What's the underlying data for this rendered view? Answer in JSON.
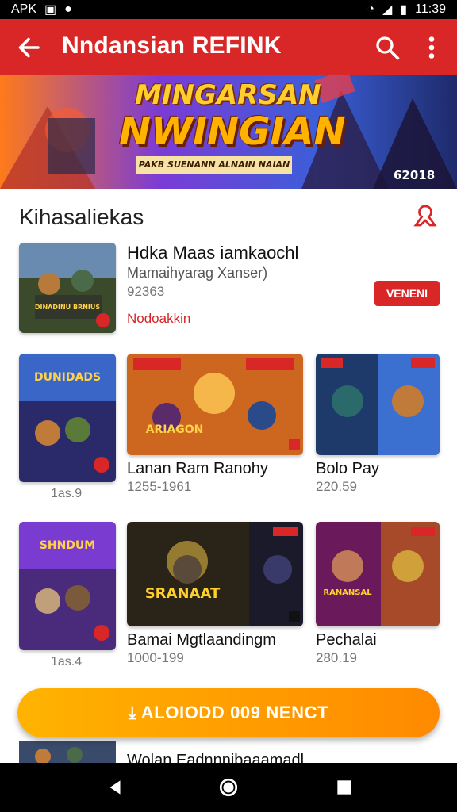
{
  "status": {
    "carrier": "APK",
    "time": "11:39"
  },
  "appbar": {
    "title": "Nndansian REFINK"
  },
  "banner": {
    "title1": "MINGARSAN",
    "title2": "NWINGIAN",
    "subtitle": "PAKB SUENANN ALNAIN NAIAN",
    "tag": "62018"
  },
  "section": {
    "title": "Kihasaliekas"
  },
  "featured": {
    "name": "Hdka Maas iamkaochl",
    "subtitle": "Mamaihyarag Xanser)",
    "meta": "92363",
    "link": "Nodoakkin",
    "button": "VENENI",
    "art": "DINADINU BRNIUS"
  },
  "cards": [
    {
      "title": "",
      "meta": "1as.9",
      "art": "DUNIDADS"
    },
    {
      "title": "Lanan Ram Ranohy",
      "meta": "1255-1961",
      "art": "ARIAGON"
    },
    {
      "title": "Bolo Pay",
      "meta": "220.59",
      "art": ""
    },
    {
      "title": "",
      "meta": "1as.4",
      "art": "SHNDUM"
    },
    {
      "title": "Bamai Mgtlaandingm",
      "meta": "1000-199",
      "art": "SRANAAT"
    },
    {
      "title": "Pechalai",
      "meta": "280.19",
      "art": "RANANSAL"
    }
  ],
  "cta": {
    "label": "ALOIODD 009 NENCT"
  },
  "peek": {
    "label": "Wolan Eadnnnibaaamadl"
  },
  "colors": {
    "accent": "#d92626",
    "cta_start": "#ffb300",
    "cta_end": "#ff8a00"
  }
}
